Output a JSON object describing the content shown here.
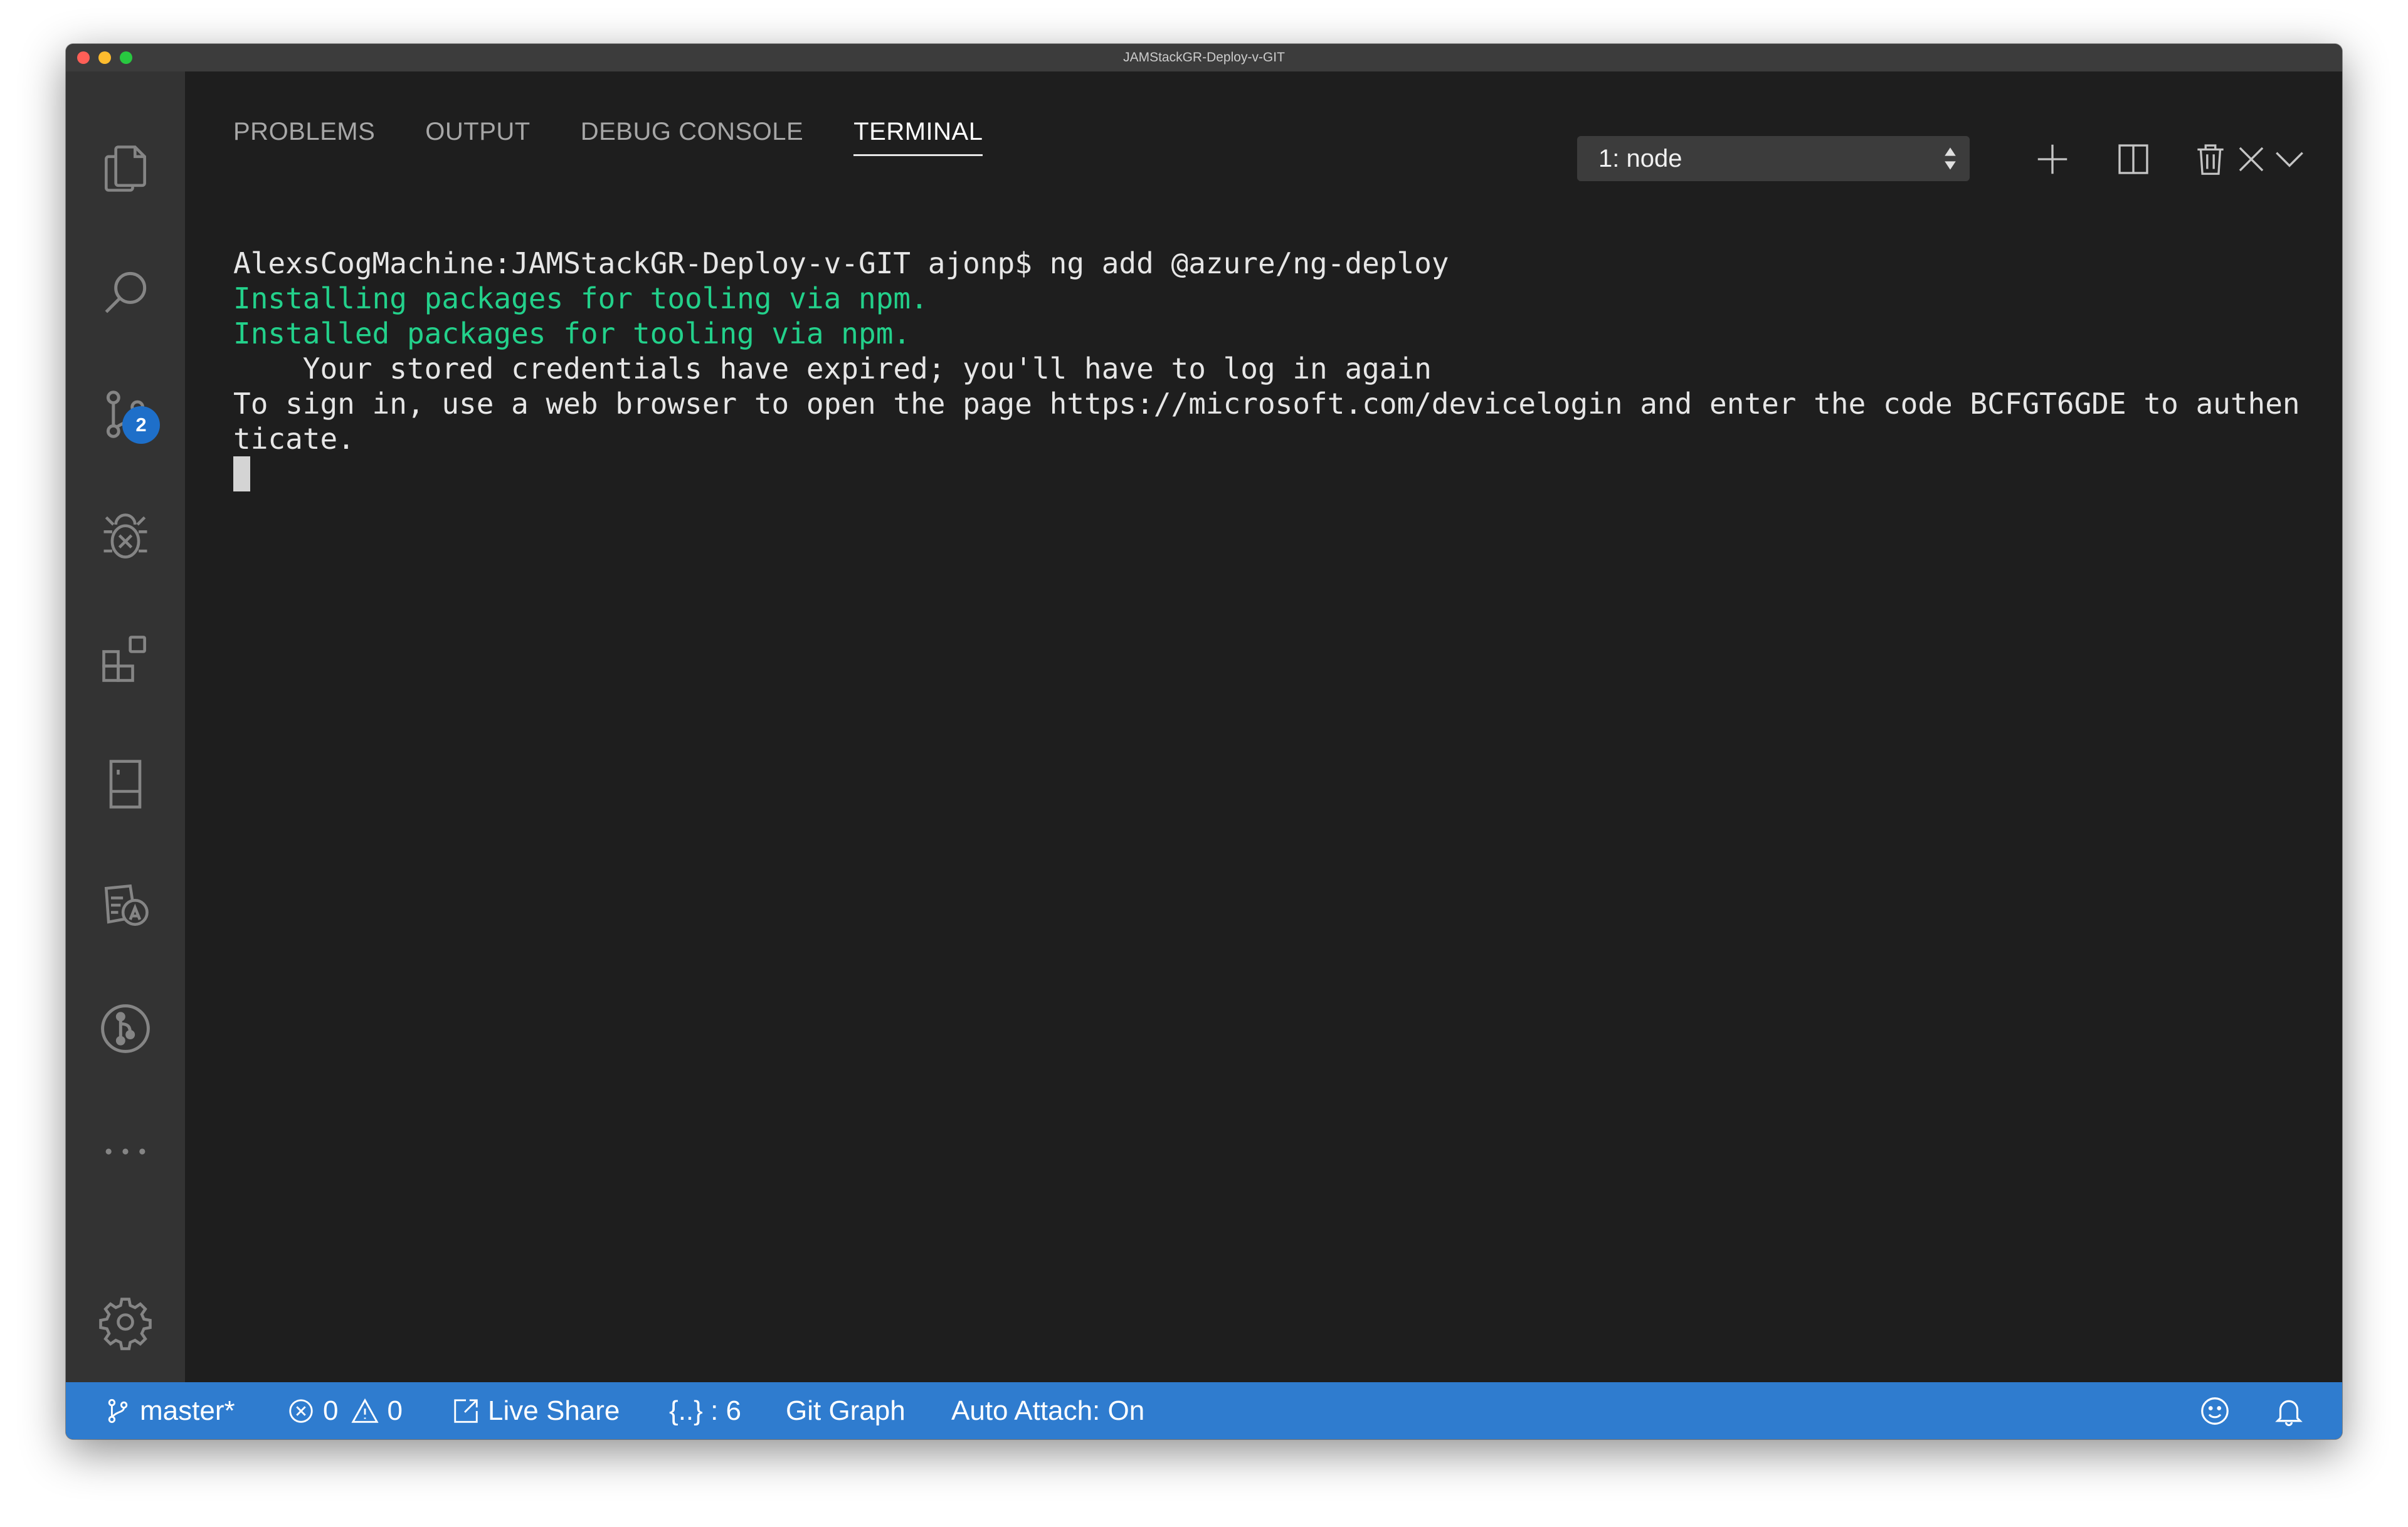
{
  "window": {
    "title": "JAMStackGR-Deploy-v-GIT"
  },
  "activity_bar": {
    "items": [
      {
        "icon": "files-icon"
      },
      {
        "icon": "search-icon"
      },
      {
        "icon": "source-control-icon",
        "badge": "2"
      },
      {
        "icon": "debug-icon"
      },
      {
        "icon": "extensions-icon"
      },
      {
        "icon": "remote-explorer-icon"
      },
      {
        "icon": "language-icon"
      },
      {
        "icon": "git-graph-icon"
      },
      {
        "icon": "more-icon"
      },
      {
        "icon": "gear-icon"
      }
    ]
  },
  "panel": {
    "tabs": [
      {
        "label": "PROBLEMS",
        "active": false
      },
      {
        "label": "OUTPUT",
        "active": false
      },
      {
        "label": "DEBUG CONSOLE",
        "active": false
      },
      {
        "label": "TERMINAL",
        "active": true
      }
    ],
    "terminal_select": "1: node",
    "actions": [
      "new-terminal-icon",
      "split-terminal-icon",
      "trash-icon",
      "chevron-down-icon",
      "close-icon"
    ]
  },
  "terminal": {
    "lines": [
      "AlexsCogMachine:JAMStackGR-Deploy-v-GIT ajonp$ ng add @azure/ng-deploy",
      "Installing packages for tooling via npm.",
      "Installed packages for tooling via npm.",
      "    Your stored credentials have expired; you'll have to log in again",
      "To sign in, use a web browser to open the page https://microsoft.com/devicelogin and enter the code BCFGT6GDE to authen",
      "ticate."
    ],
    "green_color": "#23d18b"
  },
  "status_bar": {
    "background": "#2f7ccf",
    "branch": "master*",
    "errors": "0",
    "warnings": "0",
    "live_share": "Live Share",
    "json_path": "{..} : 6",
    "git_graph": "Git Graph",
    "auto_attach": "Auto Attach: On"
  }
}
